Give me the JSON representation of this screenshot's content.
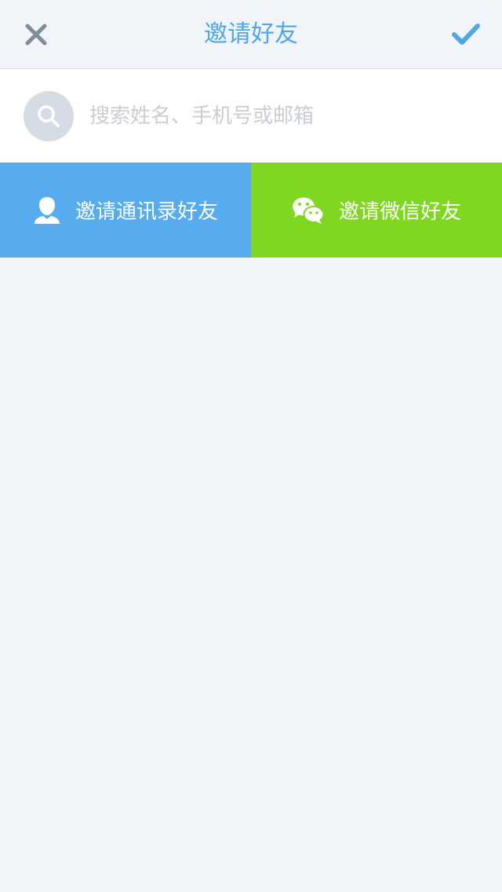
{
  "navbar": {
    "title": "邀请好友",
    "close_icon": "close-icon",
    "confirm_icon": "checkmark-icon",
    "accent_color": "#4fa7e8"
  },
  "search": {
    "placeholder": "搜索姓名、手机号或邮箱",
    "value": "",
    "icon": "search-icon"
  },
  "actions": {
    "contacts": {
      "label": "邀请通讯录好友",
      "icon": "person-icon",
      "color": "#56acef"
    },
    "wechat": {
      "label": "邀请微信好友",
      "icon": "wechat-icon",
      "color": "#7fd722"
    }
  }
}
